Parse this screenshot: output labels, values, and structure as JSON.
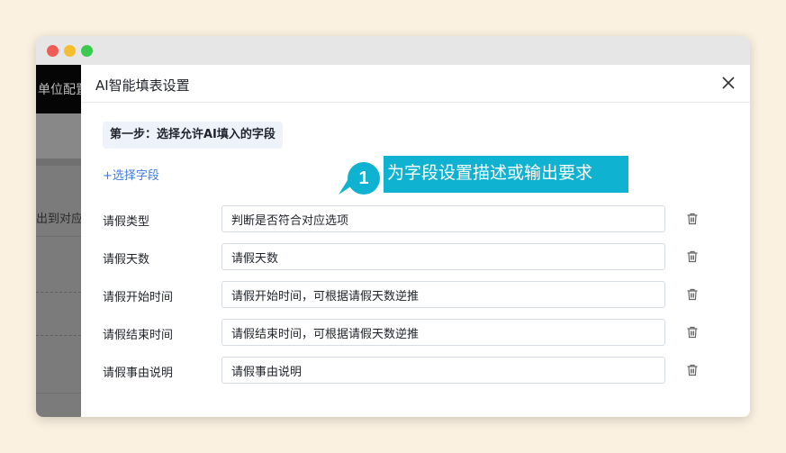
{
  "background_app": {
    "top_text": "单位配置",
    "row_text": "出到对应的"
  },
  "dialog": {
    "title": "AI智能填表设置",
    "step_label": "第一步：选择允许AI填入的字段",
    "add_field_label": "+选择字段",
    "fields": [
      {
        "label": "请假类型",
        "value": "判断是否符合对应选项"
      },
      {
        "label": "请假天数",
        "value": "请假天数"
      },
      {
        "label": "请假开始时间",
        "value": "请假开始时间，可根据请假天数逆推"
      },
      {
        "label": "请假结束时间",
        "value": "请假结束时间，可根据请假天数逆推"
      },
      {
        "label": "请假事由说明",
        "value": "请假事由说明"
      }
    ]
  },
  "callout": {
    "number": "1",
    "text": "为字段设置描述或输出要求",
    "color": "#0fb2d0"
  },
  "colors": {
    "accent": "#3f7be0",
    "page_background": "#fbf1e1"
  }
}
